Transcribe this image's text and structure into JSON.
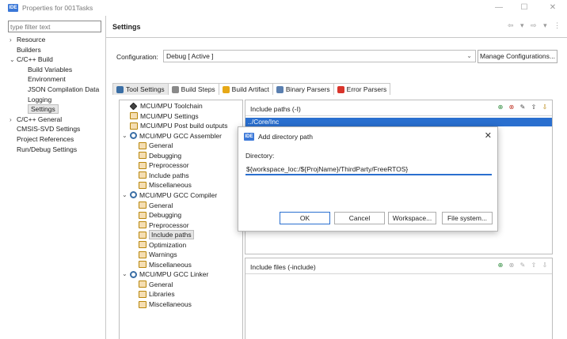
{
  "window": {
    "app_badge": "IDE",
    "title": "Properties for 001Tasks",
    "minimize": "—",
    "maximize": "☐",
    "close": "✕"
  },
  "filter": {
    "placeholder": "type filter text"
  },
  "nav_tree": [
    {
      "label": "Resource",
      "twisty": "›",
      "indent": 0
    },
    {
      "label": "Builders",
      "twisty": "",
      "indent": 0
    },
    {
      "label": "C/C++ Build",
      "twisty": "⌄",
      "indent": 0
    },
    {
      "label": "Build Variables",
      "twisty": "",
      "indent": 1
    },
    {
      "label": "Environment",
      "twisty": "",
      "indent": 1
    },
    {
      "label": "JSON Compilation Data",
      "twisty": "",
      "indent": 1
    },
    {
      "label": "Logging",
      "twisty": "",
      "indent": 1
    },
    {
      "label": "Settings",
      "twisty": "",
      "indent": 1,
      "selected": true
    },
    {
      "label": "C/C++ General",
      "twisty": "›",
      "indent": 0
    },
    {
      "label": "CMSIS-SVD Settings",
      "twisty": "",
      "indent": 0
    },
    {
      "label": "Project References",
      "twisty": "",
      "indent": 0
    },
    {
      "label": "Run/Debug Settings",
      "twisty": "",
      "indent": 0
    }
  ],
  "settings": {
    "title": "Settings",
    "nav_arrows": "⇦ ▾ ⇨ ▾ ⋮"
  },
  "configuration": {
    "label": "Configuration:",
    "value": "Debug  [ Active ]",
    "manage_button": "Manage Configurations..."
  },
  "tabs": [
    {
      "label": "Tool Settings",
      "icon_color": "#3a6ea5",
      "active": true
    },
    {
      "label": "Build Steps",
      "icon_color": "#8a8a8a",
      "active": false
    },
    {
      "label": "Build Artifact",
      "icon_color": "#e6a817",
      "active": false
    },
    {
      "label": "Binary Parsers",
      "icon_color": "#5a7fb0",
      "active": false
    },
    {
      "label": "Error Parsers",
      "icon_color": "#d9342b",
      "active": false
    }
  ],
  "tool_tree": [
    {
      "label": "MCU/MPU Toolchain",
      "icon": "tool",
      "level": 0,
      "twisty": ""
    },
    {
      "label": "MCU/MPU Settings",
      "icon": "page",
      "level": 0,
      "twisty": ""
    },
    {
      "label": "MCU/MPU Post build outputs",
      "icon": "page",
      "level": 0,
      "twisty": ""
    },
    {
      "label": "MCU/MPU GCC Assembler",
      "icon": "gear",
      "level": 0,
      "twisty": "⌄"
    },
    {
      "label": "General",
      "icon": "page",
      "level": 1,
      "twisty": ""
    },
    {
      "label": "Debugging",
      "icon": "page",
      "level": 1,
      "twisty": ""
    },
    {
      "label": "Preprocessor",
      "icon": "page",
      "level": 1,
      "twisty": ""
    },
    {
      "label": "Include paths",
      "icon": "page",
      "level": 1,
      "twisty": ""
    },
    {
      "label": "Miscellaneous",
      "icon": "page",
      "level": 1,
      "twisty": ""
    },
    {
      "label": "MCU/MPU GCC Compiler",
      "icon": "gear",
      "level": 0,
      "twisty": "⌄"
    },
    {
      "label": "General",
      "icon": "page",
      "level": 1,
      "twisty": ""
    },
    {
      "label": "Debugging",
      "icon": "page",
      "level": 1,
      "twisty": ""
    },
    {
      "label": "Preprocessor",
      "icon": "page",
      "level": 1,
      "twisty": ""
    },
    {
      "label": "Include paths",
      "icon": "page",
      "level": 1,
      "twisty": "",
      "selected": true
    },
    {
      "label": "Optimization",
      "icon": "page",
      "level": 1,
      "twisty": ""
    },
    {
      "label": "Warnings",
      "icon": "page",
      "level": 1,
      "twisty": ""
    },
    {
      "label": "Miscellaneous",
      "icon": "page",
      "level": 1,
      "twisty": ""
    },
    {
      "label": "MCU/MPU GCC Linker",
      "icon": "gear",
      "level": 0,
      "twisty": "⌄"
    },
    {
      "label": "General",
      "icon": "page",
      "level": 1,
      "twisty": ""
    },
    {
      "label": "Libraries",
      "icon": "page",
      "level": 1,
      "twisty": ""
    },
    {
      "label": "Miscellaneous",
      "icon": "page",
      "level": 1,
      "twisty": ""
    }
  ],
  "include_paths": {
    "title": "Include paths (-I)",
    "rows": [
      "../Core/Inc"
    ],
    "toolbar": [
      "add-icon",
      "delete-icon",
      "edit-icon",
      "move-up-icon",
      "move-down-icon"
    ]
  },
  "include_files": {
    "title": "Include files (-include)",
    "toolbar": [
      "add-icon",
      "delete-icon",
      "edit-icon",
      "move-up-icon",
      "move-down-icon"
    ]
  },
  "dialog": {
    "badge": "IDE",
    "title": "Add directory path",
    "close": "✕",
    "directory_label": "Directory:",
    "directory_value": "${workspace_loc:/${ProjName}/ThirdParty/FreeRTOS}",
    "ok": "OK",
    "cancel": "Cancel",
    "workspace": "Workspace...",
    "file_system": "File system..."
  },
  "colors": {
    "accent": "#2a6fcf",
    "selection_bg": "#e5e5e5"
  }
}
